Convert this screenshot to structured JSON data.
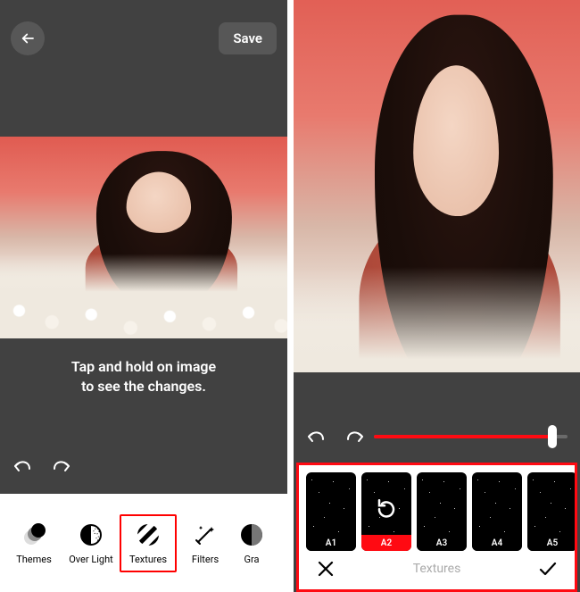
{
  "left": {
    "save_label": "Save",
    "hint_line1": "Tap and hold on image",
    "hint_line2": "to see the changes.",
    "tools": [
      {
        "label": "Themes"
      },
      {
        "label": "Over Light"
      },
      {
        "label": "Textures"
      },
      {
        "label": "Filters"
      },
      {
        "label": "Gra"
      }
    ],
    "selected_tool_index": 2
  },
  "right": {
    "slider": {
      "percent": 92
    },
    "thumbs": [
      {
        "label": "A1"
      },
      {
        "label": "A2"
      },
      {
        "label": "A3"
      },
      {
        "label": "A4"
      },
      {
        "label": "A5"
      }
    ],
    "selected_thumb_index": 1,
    "section_title": "Textures"
  }
}
